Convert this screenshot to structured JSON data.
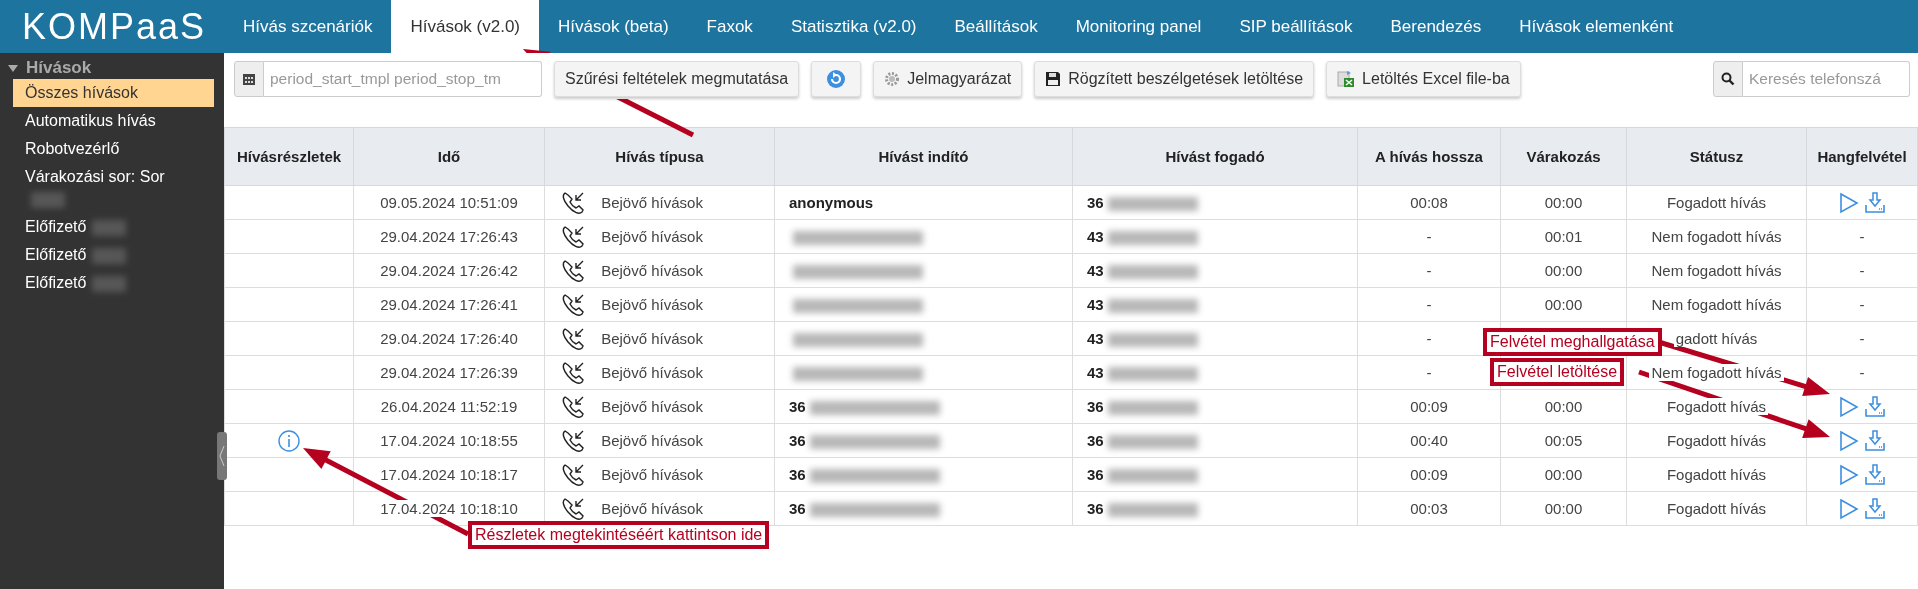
{
  "logo": "KOMPaaS",
  "tabs": [
    {
      "label": "Hívás szcenáriók",
      "selected": false
    },
    {
      "label": "Hívások (v2.0)",
      "selected": true
    },
    {
      "label": "Hívások (beta)",
      "selected": false
    },
    {
      "label": "Faxok",
      "selected": false
    },
    {
      "label": "Statisztika (v2.0)",
      "selected": false
    },
    {
      "label": "Beállítások",
      "selected": false
    },
    {
      "label": "Monitoring panel",
      "selected": false
    },
    {
      "label": "SIP beállítások",
      "selected": false
    },
    {
      "label": "Berendezés",
      "selected": false
    },
    {
      "label": "Hívások elemenként",
      "selected": false
    }
  ],
  "sidebar": {
    "heading": "Hívások",
    "expanded": true,
    "items": [
      {
        "label": "Összes hívások",
        "selected": true,
        "redacted": false
      },
      {
        "label": "Automatikus hívás",
        "selected": false,
        "redacted": false
      },
      {
        "label": "Robotvezérlő",
        "selected": false,
        "redacted": false
      },
      {
        "label": "Várakozási sor: Sor",
        "selected": false,
        "redacted": true,
        "redacted_below": true
      },
      {
        "label": "Előfizető",
        "selected": false,
        "redacted": true
      },
      {
        "label": "Előfizető",
        "selected": false,
        "redacted": true
      },
      {
        "label": "Előfizető",
        "selected": false,
        "redacted": true
      }
    ]
  },
  "toolbar": {
    "period_field": "period_start_tmpl period_stop_tm",
    "buttons": [
      {
        "kind": "text",
        "label": "Szűrési feltételek megmutatása"
      },
      {
        "kind": "refresh"
      },
      {
        "kind": "gear",
        "label": "Jelmagyarázat"
      },
      {
        "kind": "floppy",
        "label": "Rögzített beszélgetések letöltése"
      },
      {
        "kind": "excel",
        "label": "Letöltés Excel file-ba"
      }
    ],
    "search": {
      "placeholder": "Keresés telefonszá"
    }
  },
  "table": {
    "columns": [
      "Hívásrészletek",
      "Idő",
      "Hívás típusa",
      "Hívást indító",
      "Hívást fogadó",
      "A hívás hossza",
      "Várakozás",
      "Státusz",
      "Hangfelvétel"
    ],
    "rows": [
      {
        "details": false,
        "time": "09.05.2024 10:51:09",
        "type": "Bejövő hívások",
        "caller": {
          "text": "anonymous",
          "redacted": false
        },
        "callee": {
          "text": "36",
          "redacted": true
        },
        "duration": "00:08",
        "wait": "00:00",
        "status": "Fogadott hívás",
        "recording": true
      },
      {
        "details": false,
        "time": "29.04.2024 17:26:43",
        "type": "Bejövő hívások",
        "caller": {
          "redacted": true
        },
        "callee": {
          "text": "43",
          "redacted": true
        },
        "duration": "-",
        "wait": "00:01",
        "status": "Nem fogadott hívás",
        "recording": false,
        "no_recording": "-"
      },
      {
        "details": false,
        "time": "29.04.2024 17:26:42",
        "type": "Bejövő hívások",
        "caller": {
          "redacted": true
        },
        "callee": {
          "text": "43",
          "redacted": true
        },
        "duration": "-",
        "wait": "00:00",
        "status": "Nem fogadott hívás",
        "recording": false,
        "no_recording": "-"
      },
      {
        "details": false,
        "time": "29.04.2024 17:26:41",
        "type": "Bejövő hívások",
        "caller": {
          "redacted": true
        },
        "callee": {
          "text": "43",
          "redacted": true
        },
        "duration": "-",
        "wait": "00:00",
        "status": "Nem fogadott hívás",
        "recording": false,
        "no_recording": "-"
      },
      {
        "details": false,
        "time": "29.04.2024 17:26:40",
        "type": "Bejövő hívások",
        "caller": {
          "redacted": true
        },
        "callee": {
          "text": "43",
          "redacted": true
        },
        "duration": "-",
        "status": "gadott hívás",
        "recording": false,
        "no_recording": "-"
      },
      {
        "details": false,
        "time": "29.04.2024 17:26:39",
        "type": "Bejövő hívások",
        "caller": {
          "redacted": true
        },
        "callee": {
          "text": "43",
          "redacted": true
        },
        "duration": "-",
        "status": "Nem fogadott hívás",
        "recording": false,
        "no_recording": "-"
      },
      {
        "details": false,
        "time": "26.04.2024 11:52:19",
        "type": "Bejövő hívások",
        "caller": {
          "text": "36",
          "redacted": true
        },
        "callee": {
          "text": "36",
          "redacted": true
        },
        "duration": "00:09",
        "wait": "00:00",
        "status": "Fogadott hívás",
        "recording": true
      },
      {
        "details": true,
        "time": "17.04.2024 10:18:55",
        "type": "Bejövő hívások",
        "caller": {
          "text": "36",
          "redacted": true
        },
        "callee": {
          "text": "36",
          "redacted": true
        },
        "duration": "00:40",
        "wait": "00:05",
        "status": "Fogadott hívás",
        "recording": true
      },
      {
        "details": false,
        "time": "17.04.2024 10:18:17",
        "type": "Bejövő hívások",
        "caller": {
          "text": "36",
          "redacted": true
        },
        "callee": {
          "text": "36",
          "redacted": true
        },
        "duration": "00:09",
        "wait": "00:00",
        "status": "Fogadott hívás",
        "recording": true
      },
      {
        "details": false,
        "time": "17.04.2024 10:18:10",
        "type": "Bejövő hívások",
        "caller": {
          "text": "36",
          "redacted": true
        },
        "callee": {
          "text": "36",
          "redacted": true
        },
        "duration": "00:03",
        "wait": "00:00",
        "status": "Fogadott hívás",
        "recording": true
      }
    ]
  },
  "annotations": [
    {
      "text": "Felvétel meghallgatása"
    },
    {
      "text": "Felvétel letöltése"
    },
    {
      "text": "Részletek megtekintéséért kattintson ide"
    }
  ]
}
